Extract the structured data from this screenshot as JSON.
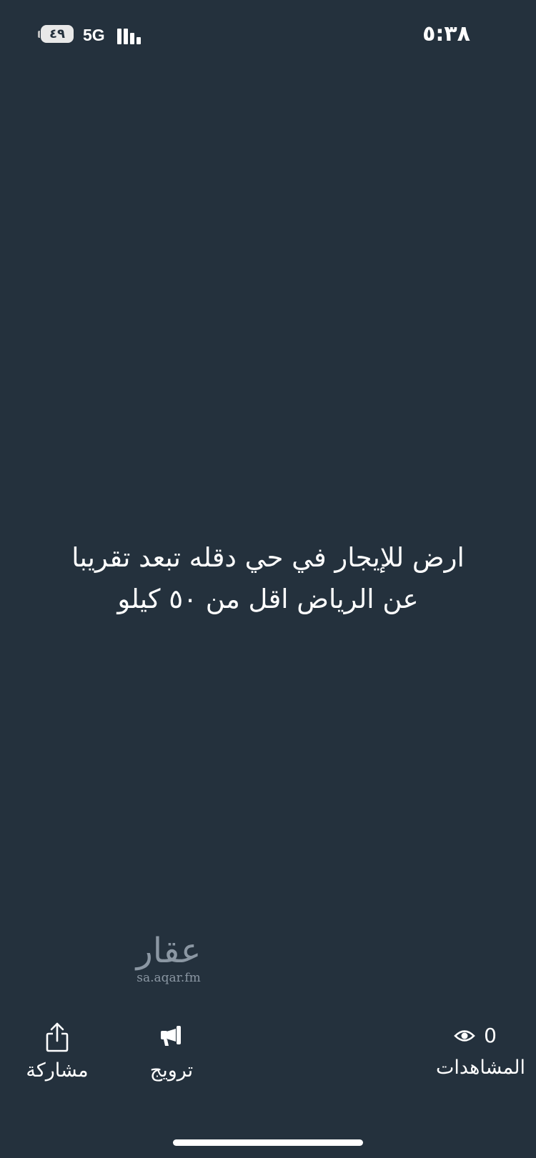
{
  "status_bar": {
    "time": "٥:٣٨",
    "battery": "٤٩",
    "network": "5G"
  },
  "post": {
    "text": "ارض  للإيجار في حي دقله تبعد تقريبا\nعن الرياض اقل من ٥٠ كيلو"
  },
  "watermark": {
    "logo_text": "عقار",
    "url": "sa.aqar.fm"
  },
  "actions": {
    "share": {
      "label": "مشاركة",
      "icon": "share-icon"
    },
    "promote": {
      "label": "ترويج",
      "icon": "megaphone-icon"
    }
  },
  "views": {
    "count": "0",
    "label": "المشاهدات",
    "icon": "eye-icon"
  },
  "colors": {
    "background": "#24313d",
    "foreground": "#ffffff",
    "watermark": "#8b97a3"
  }
}
